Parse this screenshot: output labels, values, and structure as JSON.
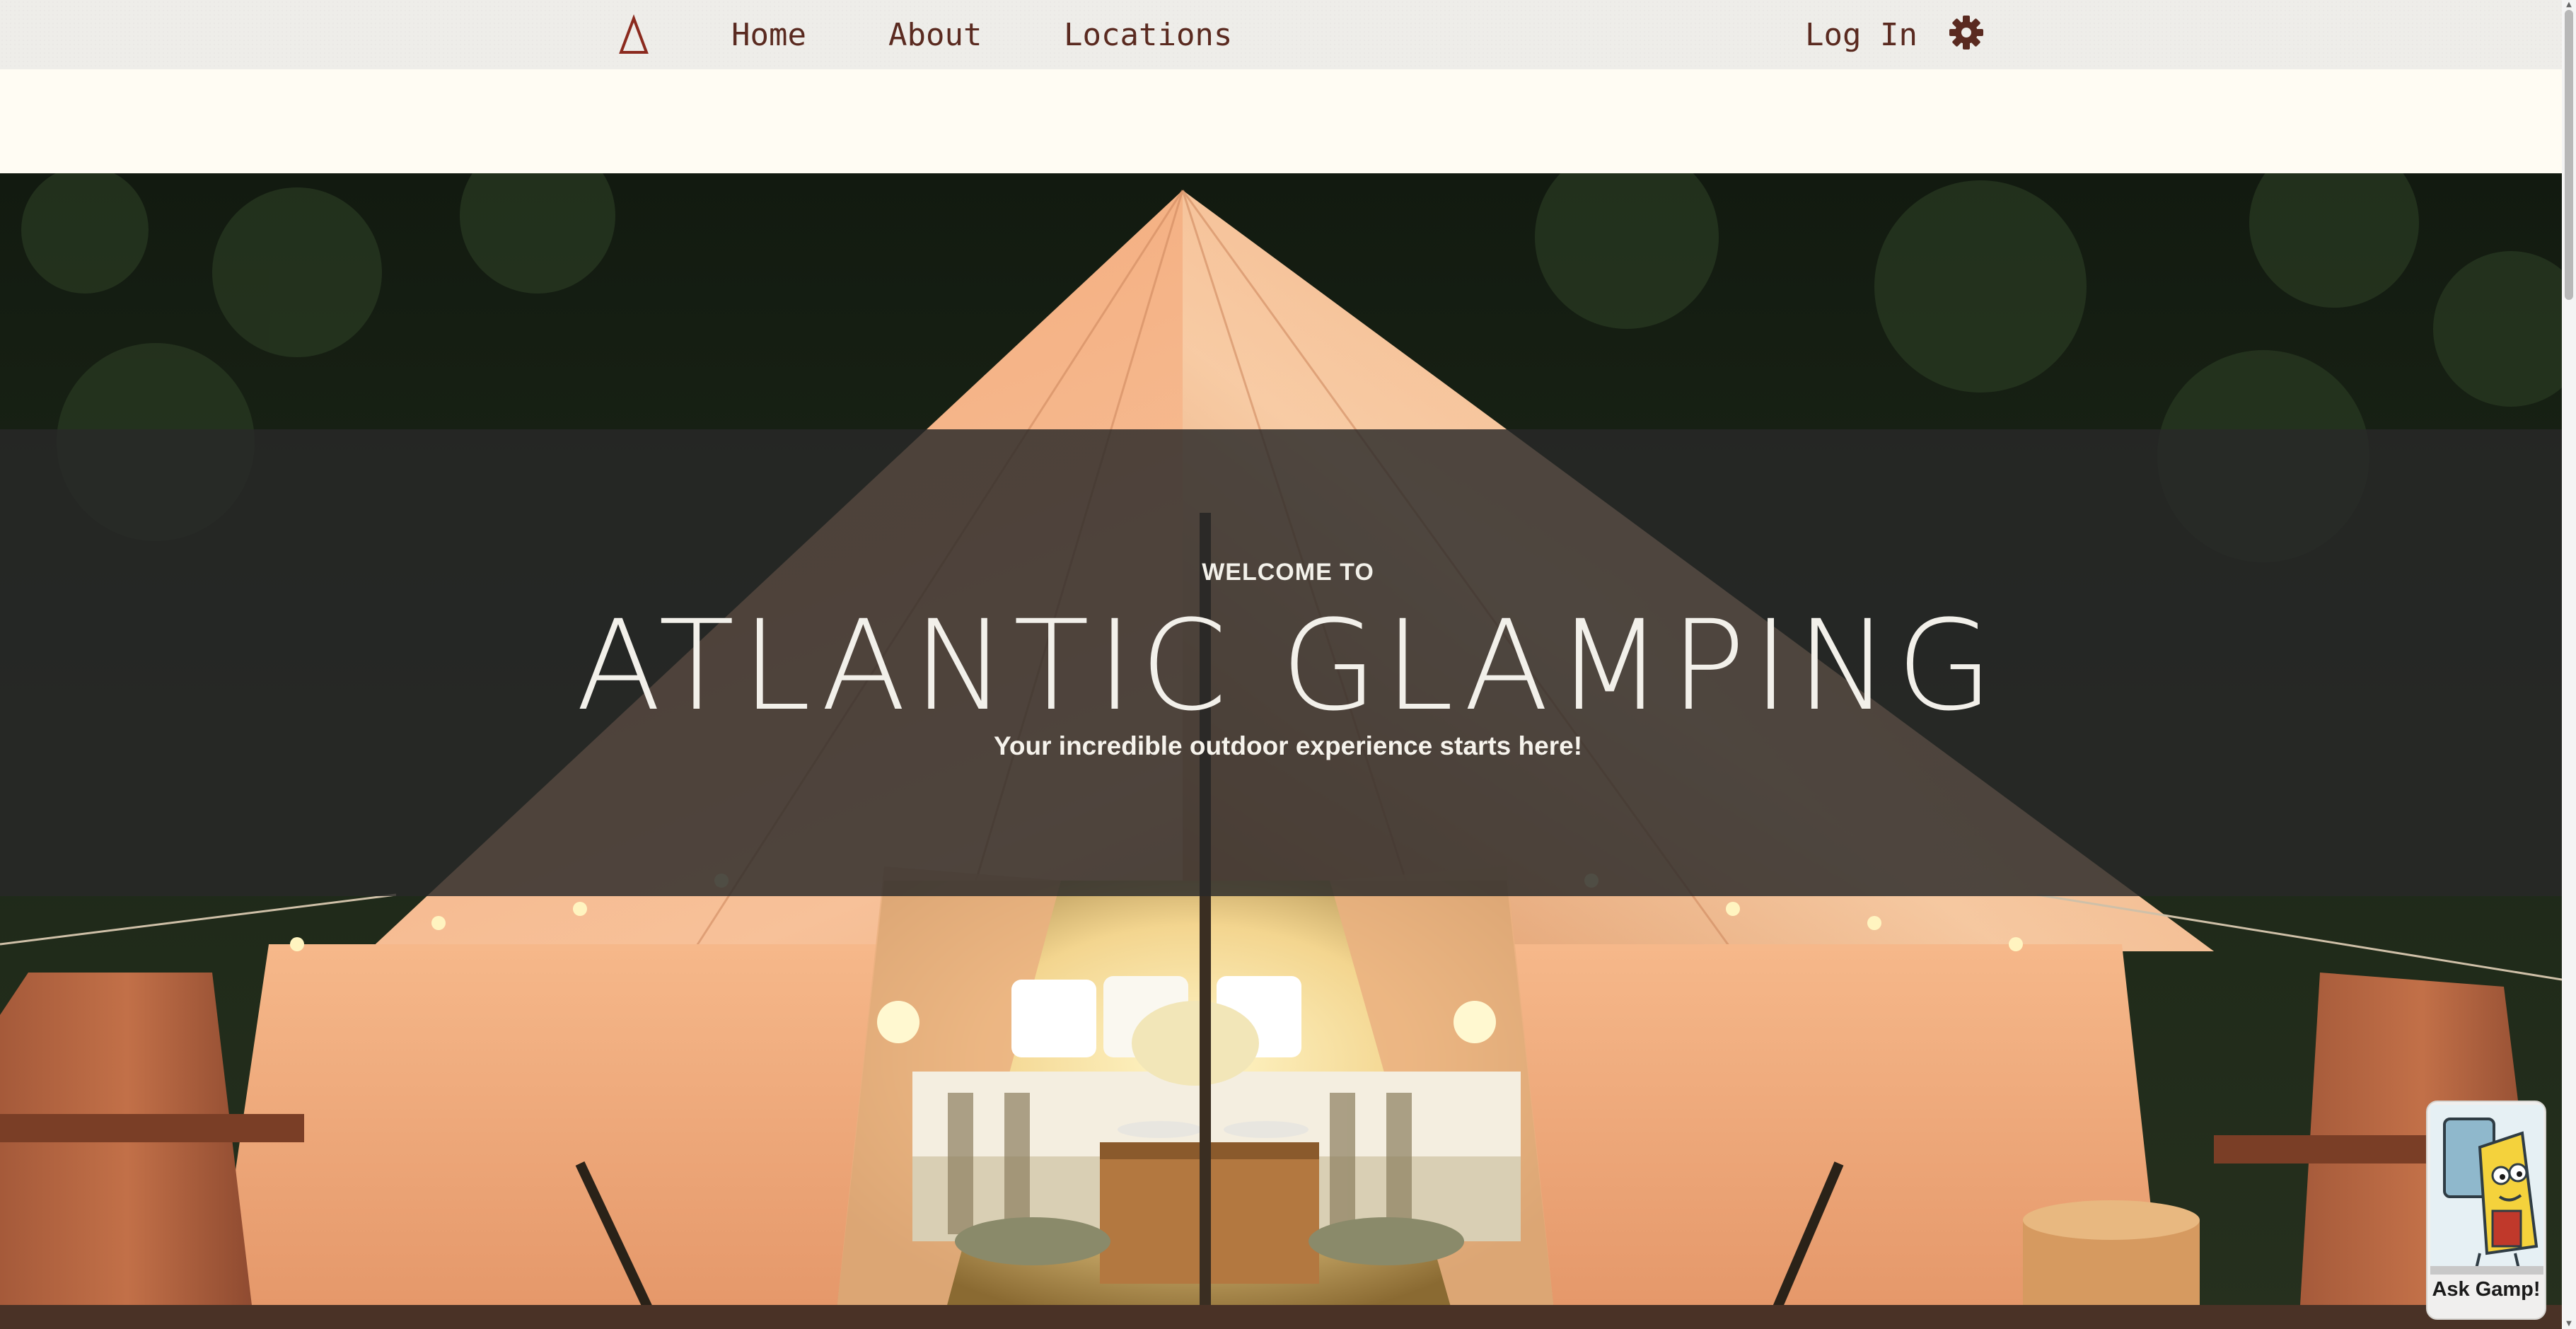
{
  "nav": {
    "logo_icon": "triangle-logo-icon",
    "home": "Home",
    "about": "About",
    "locations": "Locations",
    "login": "Log In",
    "settings_icon": "gear-icon"
  },
  "hero": {
    "eyebrow": "WELCOME TO",
    "brand": "ATLANTIC GLAMPING",
    "tagline": "Your incredible outdoor experience starts here!"
  },
  "chat_widget": {
    "label": "Ask Gamp!",
    "icon": "gamp-mascot-icon"
  },
  "colors": {
    "nav_bg": "#eeede9",
    "nav_text": "#5a2a20",
    "page_bg": "#fffcf3",
    "hero_overlay": "#282828"
  }
}
